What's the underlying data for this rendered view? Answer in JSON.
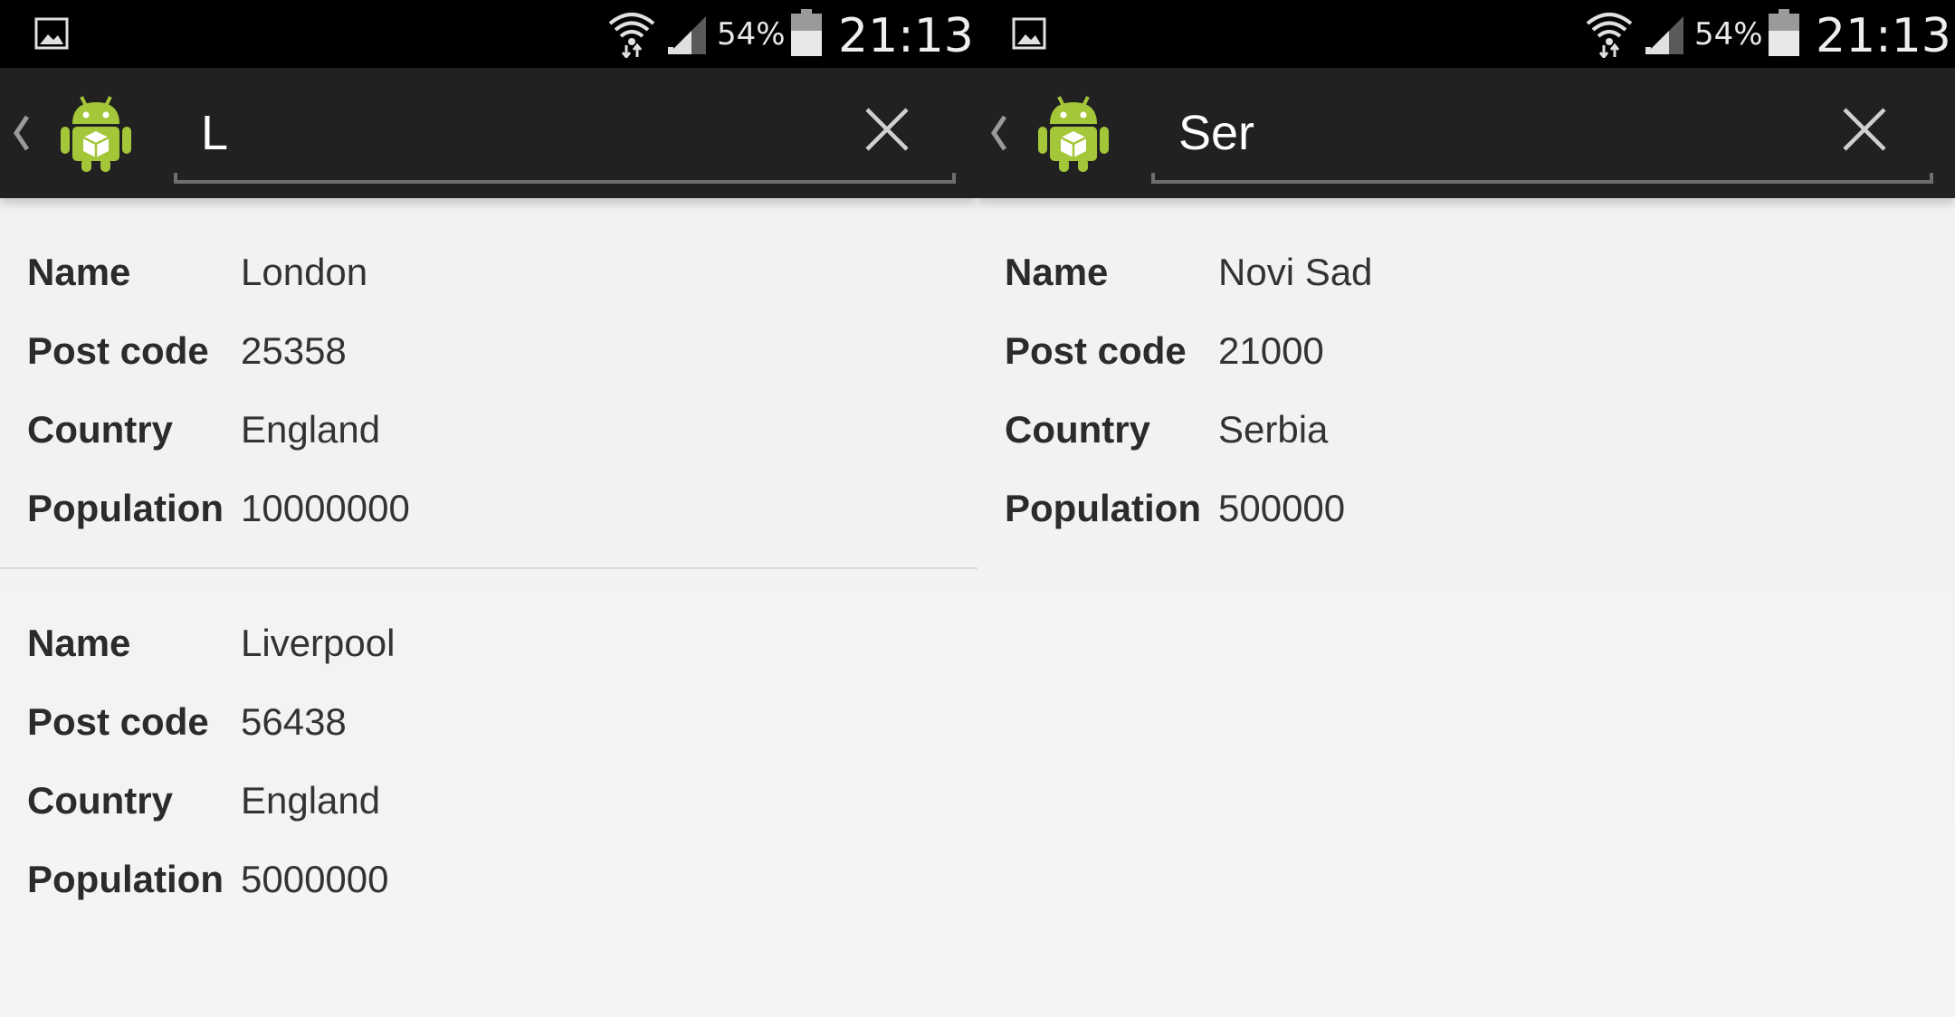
{
  "status_bar": {
    "battery_percent": "54%",
    "time": "21:13",
    "icons": [
      "gallery-icon",
      "wifi-icon",
      "signal-icon",
      "battery-icon"
    ]
  },
  "colors": {
    "status_bar_bg": "#000000",
    "action_bar_bg": "#212121",
    "content_bg": "#f2f2f2",
    "android_green": "#a4c639"
  },
  "screens": [
    {
      "search": {
        "value": "L",
        "clear_icon": "close-icon"
      },
      "records": [
        {
          "fields": [
            {
              "label": "Name",
              "value": "London"
            },
            {
              "label": "Post code",
              "value": "25358"
            },
            {
              "label": "Country",
              "value": "England"
            },
            {
              "label": "Population",
              "value": "10000000"
            }
          ]
        },
        {
          "fields": [
            {
              "label": "Name",
              "value": "Liverpool"
            },
            {
              "label": "Post code",
              "value": "56438"
            },
            {
              "label": "Country",
              "value": "England"
            },
            {
              "label": "Population",
              "value": "5000000"
            }
          ]
        }
      ]
    },
    {
      "search": {
        "value": "Ser",
        "clear_icon": "close-icon"
      },
      "records": [
        {
          "fields": [
            {
              "label": "Name",
              "value": "Novi Sad"
            },
            {
              "label": "Post code",
              "value": "21000"
            },
            {
              "label": "Country",
              "value": "Serbia"
            },
            {
              "label": "Population",
              "value": "500000"
            }
          ]
        }
      ]
    }
  ]
}
